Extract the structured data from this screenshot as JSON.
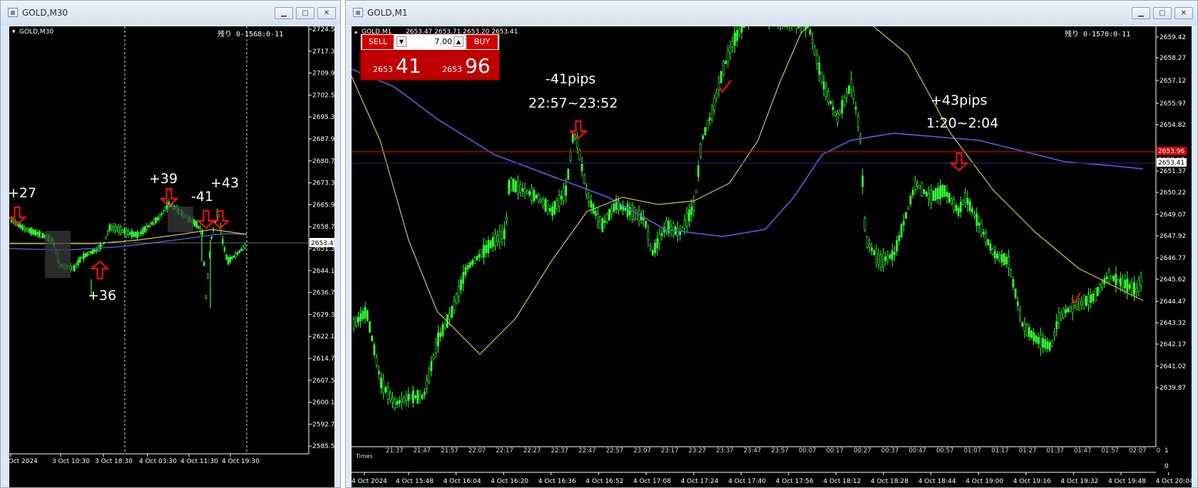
{
  "left_window": {
    "title": "GOLD,M30",
    "chart_label": "GOLD,M30",
    "countdown": "残り 0-1568:0-11",
    "price_axis": [
      "2724.50",
      "2717.30",
      "2709.90",
      "2702.50",
      "2695.30",
      "2687.90",
      "2680.70",
      "2673.30",
      "2665.90",
      "2658.70",
      "2651.30",
      "2644.10",
      "2636.70",
      "2629.30",
      "2622.10",
      "2614.70",
      "2607.50",
      "2600.10",
      "2592.70",
      "2585.50"
    ],
    "current_price": "2653.41",
    "time_axis": [
      "3 Oct 2024",
      "3 Oct 10:30",
      "3 Oct 18:30",
      "4 Oct 03:30",
      "4 Oct 11:30",
      "4 Oct 19:30"
    ],
    "annotations": [
      "+27",
      "+36",
      "+39",
      "-41",
      "+43"
    ]
  },
  "right_window": {
    "title": "GOLD,M1",
    "chart_label": "GOLD,M1",
    "ohlc": "2653.47 2653.71 2653.20 2653.41",
    "countdown": "残り 0-1570:0-11",
    "trade_panel": {
      "sell_label": "SELL",
      "buy_label": "BUY",
      "lot": "7.00",
      "sell_small": "2653",
      "sell_big": "41",
      "buy_small": "2653",
      "buy_big": "96"
    },
    "price_axis": [
      "2659.42",
      "2658.27",
      "2657.12",
      "2655.97",
      "2654.82",
      "2652.52",
      "2651.37",
      "2650.22",
      "2649.07",
      "2647.92",
      "2646.77",
      "2645.62",
      "2644.47",
      "2643.32",
      "2642.17",
      "2641.02",
      "2639.87"
    ],
    "price_tag_red": "2653.96",
    "price_tag_current": "2653.41",
    "price_tag_hidden": "2653.67",
    "indicator_axis": [
      "1",
      "0"
    ],
    "local_time_axis": [
      "21:37",
      "21:47",
      "21:57",
      "22:07",
      "22:17",
      "22:27",
      "22:37",
      "22:47",
      "22:57",
      "23:07",
      "23:17",
      "23:27",
      "23:37",
      "23:47",
      "23:57",
      "00:07",
      "00:17",
      "00:27",
      "00:37",
      "00:47",
      "00:57",
      "01:07",
      "01:17",
      "01:27",
      "01:37",
      "01:47",
      "01:57",
      "02:07",
      "0"
    ],
    "indicator_label": "Times",
    "time_axis": [
      "4 Oct 2024",
      "4 Oct 15:48",
      "4 Oct 16:04",
      "4 Oct 16:20",
      "4 Oct 16:36",
      "4 Oct 16:52",
      "4 Oct 17:08",
      "4 Oct 17:24",
      "4 Oct 17:40",
      "4 Oct 17:56",
      "4 Oct 18:12",
      "4 Oct 18:28",
      "4 Oct 18:44",
      "4 Oct 19:00",
      "4 Oct 19:16",
      "4 Oct 19:32",
      "4 Oct 19:48",
      "4 Oct 20:04"
    ],
    "annotation_loss_pips": "-41pips",
    "annotation_loss_time": "22:57~23:52",
    "annotation_gain_pips": "+43pips",
    "annotation_gain_time": "1:20~2:04"
  },
  "colors": {
    "chart_bg": "#000000",
    "candle": "#33ff33",
    "ma_fast": "#d8c04a",
    "ma_slow": "#5555cc",
    "signal_arrow": "#ff1010",
    "price_line_red": "#cc0000",
    "price_line_blue": "#1a1a66"
  }
}
